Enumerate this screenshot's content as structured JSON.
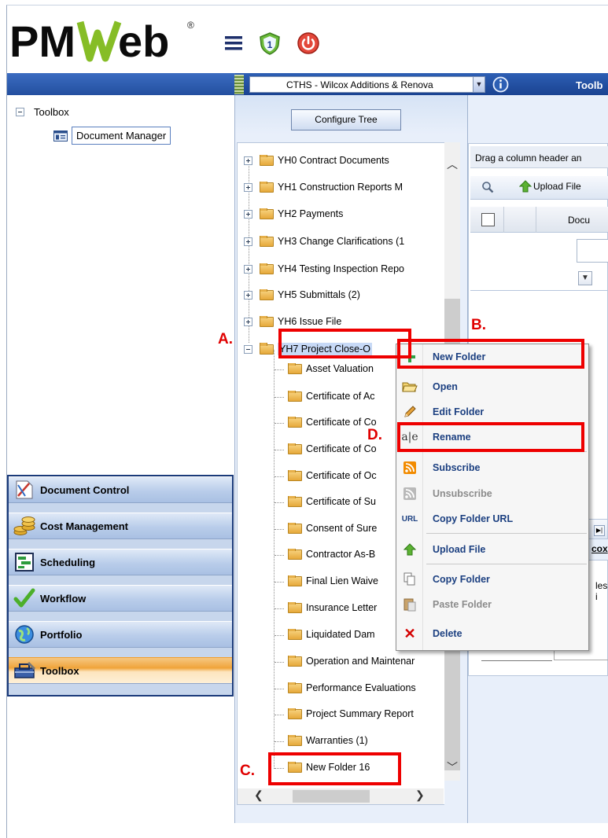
{
  "header": {
    "logo_text": "PMWeb",
    "logo_mark": "®",
    "hamburger_icon": "hamburger-menu-icon",
    "shield_badge": "1",
    "power_icon": "power-icon"
  },
  "top_bar": {
    "project_select": "CTHS - Wilcox Additions & Renova",
    "toolbox_tab": "Toolb"
  },
  "left_tree": {
    "root_label": "Toolbox",
    "child_label": "Document Manager"
  },
  "nav": [
    {
      "label": "Document Control",
      "icon": "document-control-icon"
    },
    {
      "label": "Cost Management",
      "icon": "coins-icon"
    },
    {
      "label": "Scheduling",
      "icon": "scheduling-icon"
    },
    {
      "label": "Workflow",
      "icon": "checkmark-icon"
    },
    {
      "label": "Portfolio",
      "icon": "globe-icon"
    },
    {
      "label": "Toolbox",
      "icon": "toolbox-icon",
      "active": true
    }
  ],
  "folder_pane": {
    "configure_button": "Configure Tree",
    "top_folders": [
      "YH0 Contract Documents",
      "YH1 Construction Reports M",
      "YH2 Payments",
      "YH3 Change Clarifications (1",
      "YH4 Testing Inspection Repo",
      "YH5 Submittals (2)",
      "YH6 Issue File",
      "YH7 Project Close-O"
    ],
    "sub_folders": [
      "Asset Valuation",
      "Certificate of Ac",
      "Certificate of Co",
      "Certificate of Co",
      "Certificate of Oc",
      "Certificate of Su",
      "Consent of Sure",
      "Contractor As-B",
      "Final Lien Waive",
      "Insurance Letter",
      "Liquidated Dam",
      "Operation and Maintenar",
      "Performance Evaluations",
      "Project Summary Report",
      "Warranties (1)",
      "New Folder 16"
    ]
  },
  "grid": {
    "group_hint": "Drag a column header an",
    "upload_label": "Upload File",
    "doc_column": "Docu",
    "lower_label": "cox",
    "lower_text": "les i"
  },
  "context_menu": [
    {
      "label": "New Folder",
      "icon": "plus-icon",
      "color": "#2ea043",
      "disabled": false
    },
    {
      "label": "Open",
      "icon": "open-folder-icon",
      "disabled": false
    },
    {
      "label": "Edit Folder",
      "icon": "pencil-icon",
      "disabled": false
    },
    {
      "label": "Rename",
      "icon": "rename-text-icon",
      "disabled": false
    },
    {
      "label": "Subscribe",
      "icon": "rss-icon",
      "color": "#f28b00",
      "disabled": false
    },
    {
      "label": "Unsubscribe",
      "icon": "rss-disabled-icon",
      "disabled": true
    },
    {
      "label": "Copy Folder URL",
      "icon": "url-icon",
      "disabled": false
    },
    {
      "label": "Upload File",
      "icon": "upload-arrow-icon",
      "disabled": false
    },
    {
      "label": "Copy Folder",
      "icon": "copy-icon",
      "disabled": false
    },
    {
      "label": "Paste Folder",
      "icon": "paste-icon",
      "disabled": true
    },
    {
      "label": "Delete",
      "icon": "delete-x-icon",
      "color": "#d40000",
      "disabled": false
    }
  ],
  "annotations": {
    "a": "A.",
    "b": "B.",
    "c": "C.",
    "d": "D."
  },
  "colors": {
    "annotation_red": "#ee0000",
    "header_blue": "#1a4391",
    "active_nav_orange": "#f0a43a",
    "menu_text_blue": "#1b3f80"
  }
}
